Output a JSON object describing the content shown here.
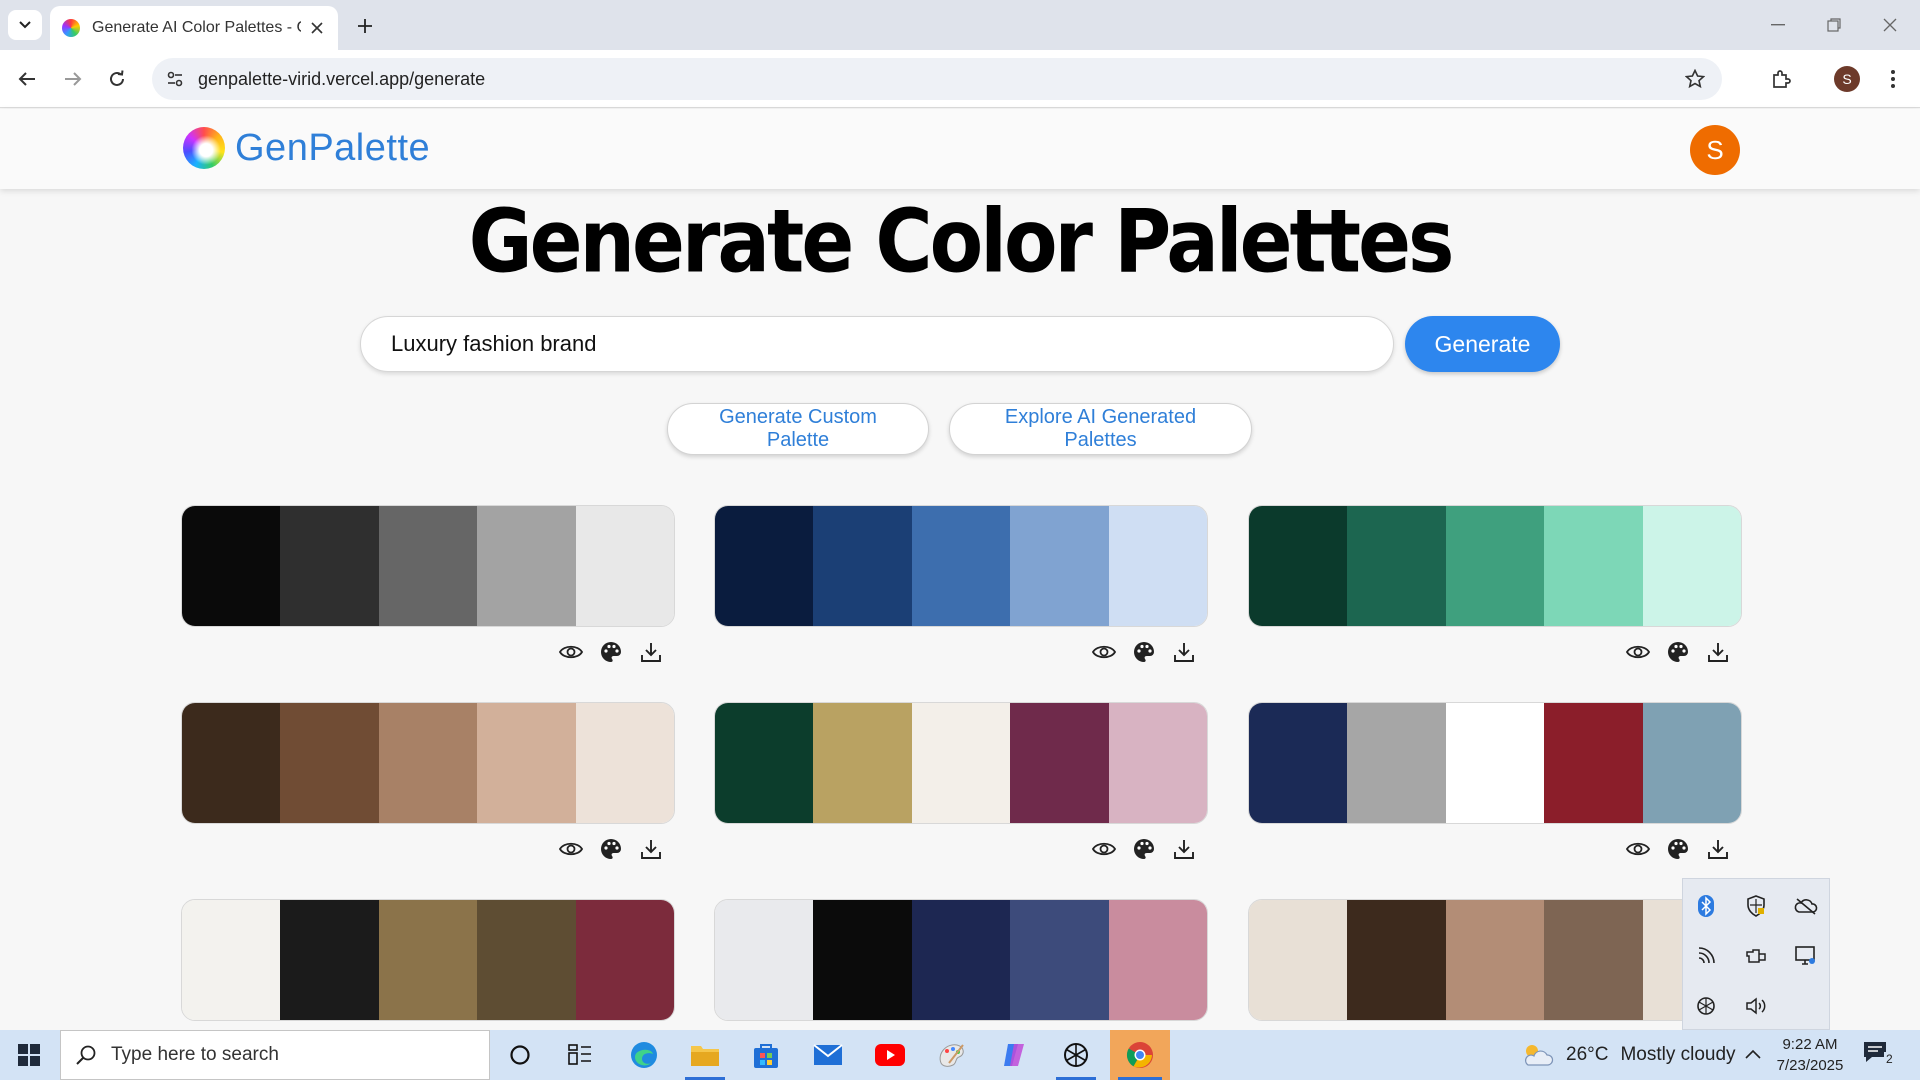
{
  "browser": {
    "tab_title": "Generate AI Color Palettes - GenPalette",
    "url": "genpalette-virid.vercel.app/generate",
    "profile_initial": "S"
  },
  "app": {
    "logo_text": "GenPalette",
    "avatar_initial": "S",
    "page_title": "Generate Color Palettes",
    "search_value": "Luxury fashion brand",
    "generate_label": "Generate",
    "custom_palette_label": "Generate Custom Palette",
    "explore_label": "Explore AI Generated Palettes"
  },
  "palettes": [
    [
      "#0a0a0a",
      "#2f2f2f",
      "#666666",
      "#a3a3a3",
      "#e8e8e8"
    ],
    [
      "#0a1c3e",
      "#1b3f75",
      "#3d6eae",
      "#80a3d1",
      "#cfdef3"
    ],
    [
      "#0b3a2c",
      "#1c6650",
      "#3fa07e",
      "#7dd7b7",
      "#ccf4e8"
    ],
    [
      "#3c2a1c",
      "#704c34",
      "#a88166",
      "#d2b09a",
      "#ede2d9"
    ],
    [
      "#0c3d2c",
      "#b9a262",
      "#f3efe9",
      "#6f2a4b",
      "#d8b3c2"
    ],
    [
      "#1b2a56",
      "#a6a6a6",
      "#ffffff",
      "#8b1e2a",
      "#7fa1b3"
    ],
    [
      "#f3f2ee",
      "#1b1b1b",
      "#8b734a",
      "#5e4d33",
      "#7c2b3c"
    ],
    [
      "#e9eaed",
      "#0b0b0b",
      "#1d2752",
      "#3d4b7b",
      "#c98c9e"
    ],
    [
      "#e8e0d6",
      "#3d2a1d",
      "#b38d76",
      "#7e6553",
      "#e8e0d6"
    ]
  ],
  "taskbar": {
    "search_placeholder": "Type here to search",
    "temperature": "26°C",
    "weather": "Mostly cloudy",
    "time": "9:22 AM",
    "date": "7/23/2025",
    "notification_count": "2"
  }
}
